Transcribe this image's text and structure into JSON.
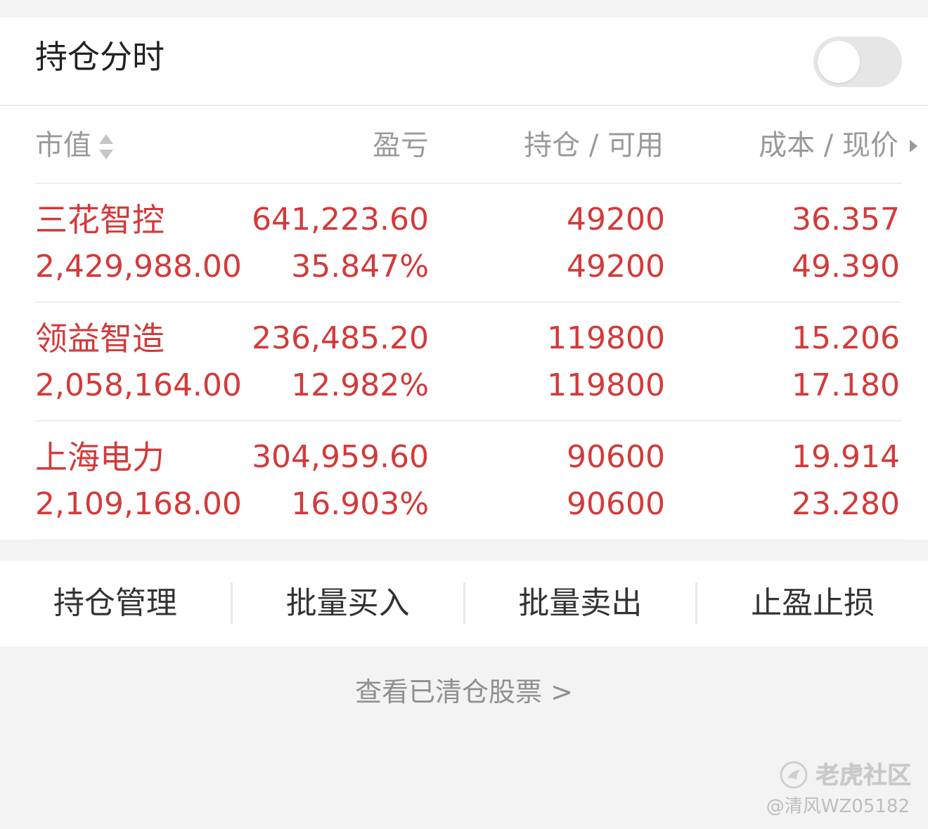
{
  "header": {
    "title": "持仓分时",
    "toggle_on": false
  },
  "table": {
    "columns": [
      "市值",
      "盈亏",
      "持仓 / 可用",
      "成本 / 现价"
    ],
    "rows": [
      {
        "name": "三花智控",
        "market_value": "2,429,988.00",
        "pnl": "641,223.60",
        "pnl_pct": "35.847%",
        "position": "49200",
        "available": "49200",
        "cost": "36.357",
        "price": "49.390"
      },
      {
        "name": "领益智造",
        "market_value": "2,058,164.00",
        "pnl": "236,485.20",
        "pnl_pct": "12.982%",
        "position": "119800",
        "available": "119800",
        "cost": "15.206",
        "price": "17.180"
      },
      {
        "name": "上海电力",
        "market_value": "2,109,168.00",
        "pnl": "304,959.60",
        "pnl_pct": "16.903%",
        "position": "90600",
        "available": "90600",
        "cost": "19.914",
        "price": "23.280"
      }
    ]
  },
  "actions": [
    "持仓管理",
    "批量买入",
    "批量卖出",
    "止盈止损"
  ],
  "cleared_link": "查看已清仓股票 >",
  "watermark": {
    "brand": "老虎社区",
    "user": "@清风WZ05182"
  },
  "colors": {
    "gain": "#d33a3a",
    "muted": "#9a9a9a",
    "background": "#f3f3f3"
  },
  "icons": [
    "sort-arrows-icon",
    "chevron-right-icon",
    "tiger-logo-icon"
  ]
}
